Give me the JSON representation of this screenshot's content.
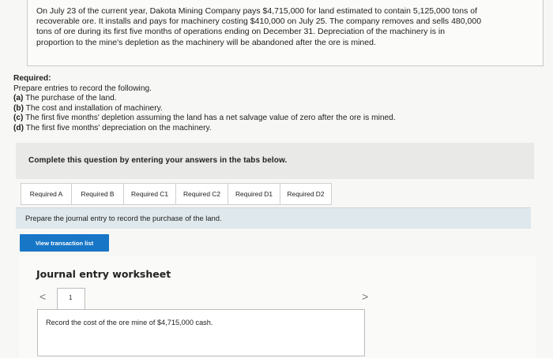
{
  "problem": {
    "lines": [
      "On July 23 of the current year, Dakota Mining Company pays $4,715,000 for land estimated to contain 5,125,000 tons of",
      "recoverable ore. It installs and pays for machinery costing $410,000 on July 25. The company removes and sells 480,000",
      "tons of ore during its first five months of operations ending on December 31. Depreciation of the machinery is in",
      "proportion to the mine's depletion as the machinery will be abandoned after the ore is mined."
    ]
  },
  "required": {
    "heading": "Required:",
    "intro": "Prepare entries to record the following.",
    "items": [
      {
        "label": "(a)",
        "text": " The purchase of the land."
      },
      {
        "label": "(b)",
        "text": " The cost and installation of machinery."
      },
      {
        "label": "(c)",
        "text": " The first five months' depletion assuming the land has a net salvage value of zero after the ore is mined."
      },
      {
        "label": "(d)",
        "text": " The first five months' depreciation on the machinery."
      }
    ]
  },
  "complete_bar": {
    "text": "Complete this question by entering your answers in the tabs below."
  },
  "tabs": [
    "Required A",
    "Required B",
    "Required C1",
    "Required C2",
    "Required D1",
    "Required D2"
  ],
  "instruction": "Prepare the journal entry to record the purchase of the land.",
  "view_transaction_button": "View transaction list",
  "worksheet": {
    "title": "Journal entry worksheet",
    "prev_icon": "<",
    "next_icon": ">",
    "page": "1",
    "description": "Record the cost of the ore mine of $4,715,000 cash."
  }
}
